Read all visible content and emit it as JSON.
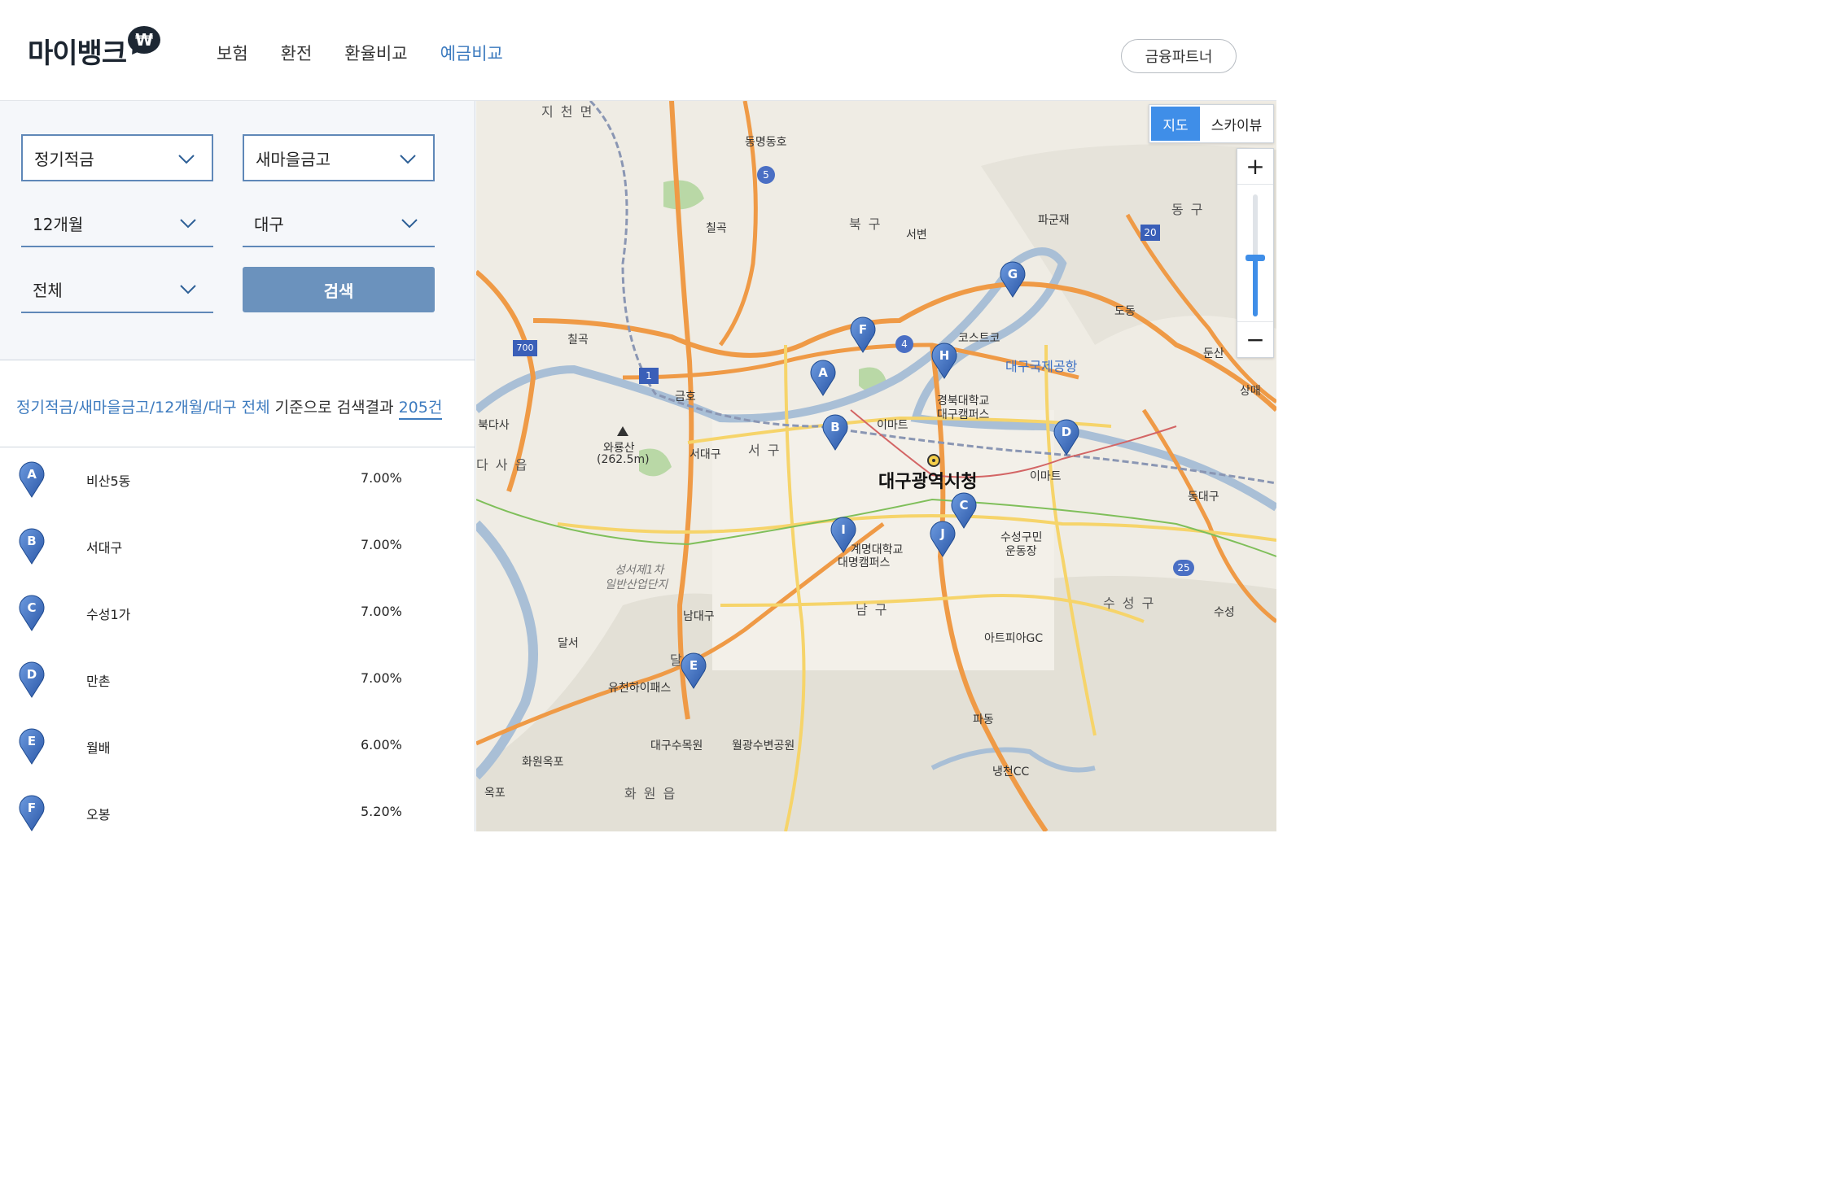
{
  "header": {
    "logo_text": "마이뱅크",
    "logo_badge": "₩",
    "nav": [
      {
        "label": "보험",
        "active": false
      },
      {
        "label": "환전",
        "active": false
      },
      {
        "label": "환율비교",
        "active": false
      },
      {
        "label": "예금비교",
        "active": true
      }
    ],
    "partner_button": "금융파트너"
  },
  "filters": {
    "product_type": "정기적금",
    "institution": "새마을금고",
    "period": "12개월",
    "region": "대구",
    "district": "전체",
    "search_button": "검색"
  },
  "summary": {
    "query": "정기적금/새마을금고/12개월/대구 전체",
    "text": " 기준으로 검색결과 ",
    "count": "205건"
  },
  "results": [
    {
      "marker": "A",
      "name": "비산5동",
      "rate": "7.00%"
    },
    {
      "marker": "B",
      "name": "서대구",
      "rate": "7.00%"
    },
    {
      "marker": "C",
      "name": "수성1가",
      "rate": "7.00%"
    },
    {
      "marker": "D",
      "name": "만촌",
      "rate": "7.00%"
    },
    {
      "marker": "E",
      "name": "월배",
      "rate": "6.00%"
    },
    {
      "marker": "F",
      "name": "오봉",
      "rate": "5.20%"
    }
  ],
  "map": {
    "view_toggle": {
      "map": "지도",
      "sky": "스카이뷰"
    },
    "zoom_in": "+",
    "zoom_out": "−",
    "zoom_level": 0.45,
    "pin_color": "#3b6fc4",
    "markers": [
      "A",
      "B",
      "C",
      "D",
      "E",
      "F",
      "G",
      "H",
      "I",
      "J"
    ],
    "labels": {
      "city_hall": "대구광역시청",
      "buk_gu": "북 구",
      "seo_gu": "서 구",
      "nam_gu": "남 구",
      "suseong_gu": "수 성 구",
      "dong_gu": "동 구",
      "dalseo": "달 서",
      "jicheon": "지 천 면",
      "dasa": "다 사 읍",
      "hwawon": "화 원 읍",
      "dongmyeong": "동명동호",
      "chilgok_ic": "칠곡",
      "chilgok2": "칠곡",
      "seobyeon": "서변",
      "pagunjae": "파군재",
      "dodong": "도동",
      "dunsan": "둔산",
      "sangmae": "상매",
      "geumho": "금호",
      "bukdaegu_west": "북다사",
      "waryongsan": "와룡산",
      "waryongsan_h": "(262.5m)",
      "seodaegu": "서대구",
      "costco": "코스트코",
      "airport": "대구국제공항",
      "knu": "경북대학교",
      "knu2": "대구캠퍼스",
      "emart1": "이마트",
      "emart2": "이마트",
      "keimyung": "계명대학교",
      "keimyung2": "대명캠퍼스",
      "suseong_stadium": "수성구민",
      "suseong_stadium2": "운동장",
      "atopia": "아트피아GC",
      "dongdaegu": "동대구",
      "seongseo": "성서제1차",
      "seongseo2": "일반산업단지",
      "namdaegu": "남대구",
      "dalseo_ic": "달서",
      "yuchun": "유천하이패스",
      "hwawonokpo": "화원옥포",
      "okpo": "옥포",
      "arboretum": "대구수목원",
      "wolgwang": "월광수변공원",
      "padong": "파동",
      "naengcheon": "냉천CC",
      "suseong_ic": "수성",
      "road_5": "5",
      "road_4": "4",
      "road_1": "1",
      "road_20": "20",
      "road_25": "25",
      "road_700": "700"
    }
  }
}
